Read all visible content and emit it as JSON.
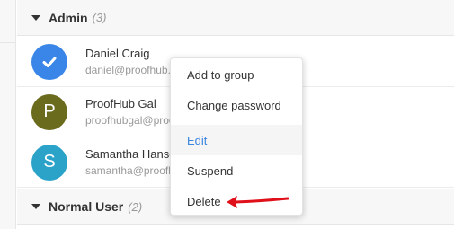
{
  "groups": {
    "admin": {
      "name": "Admin",
      "count": "(3)"
    },
    "normal": {
      "name": "Normal User",
      "count": "(2)"
    }
  },
  "users": [
    {
      "name": "Daniel Craig",
      "email": "daniel@proofhub.com",
      "avatar_icon": "check-icon",
      "avatar_color": "#3a86e8"
    },
    {
      "name": "ProofHub Gal",
      "email": "proofhubgal@proofhub.com",
      "avatar_letter": "P",
      "avatar_color": "#6b6b1e"
    },
    {
      "name": "Samantha Hanson",
      "email": "samantha@proofhub.com",
      "avatar_letter": "S",
      "avatar_color": "#2ba3c9"
    }
  ],
  "context_menu": {
    "items": [
      "Add to group",
      "Change password",
      "Edit",
      "Suspend",
      "Delete"
    ],
    "highlighted": "Edit"
  },
  "colors": {
    "accent": "#3b86e0",
    "annotation_arrow": "#e0101a"
  }
}
